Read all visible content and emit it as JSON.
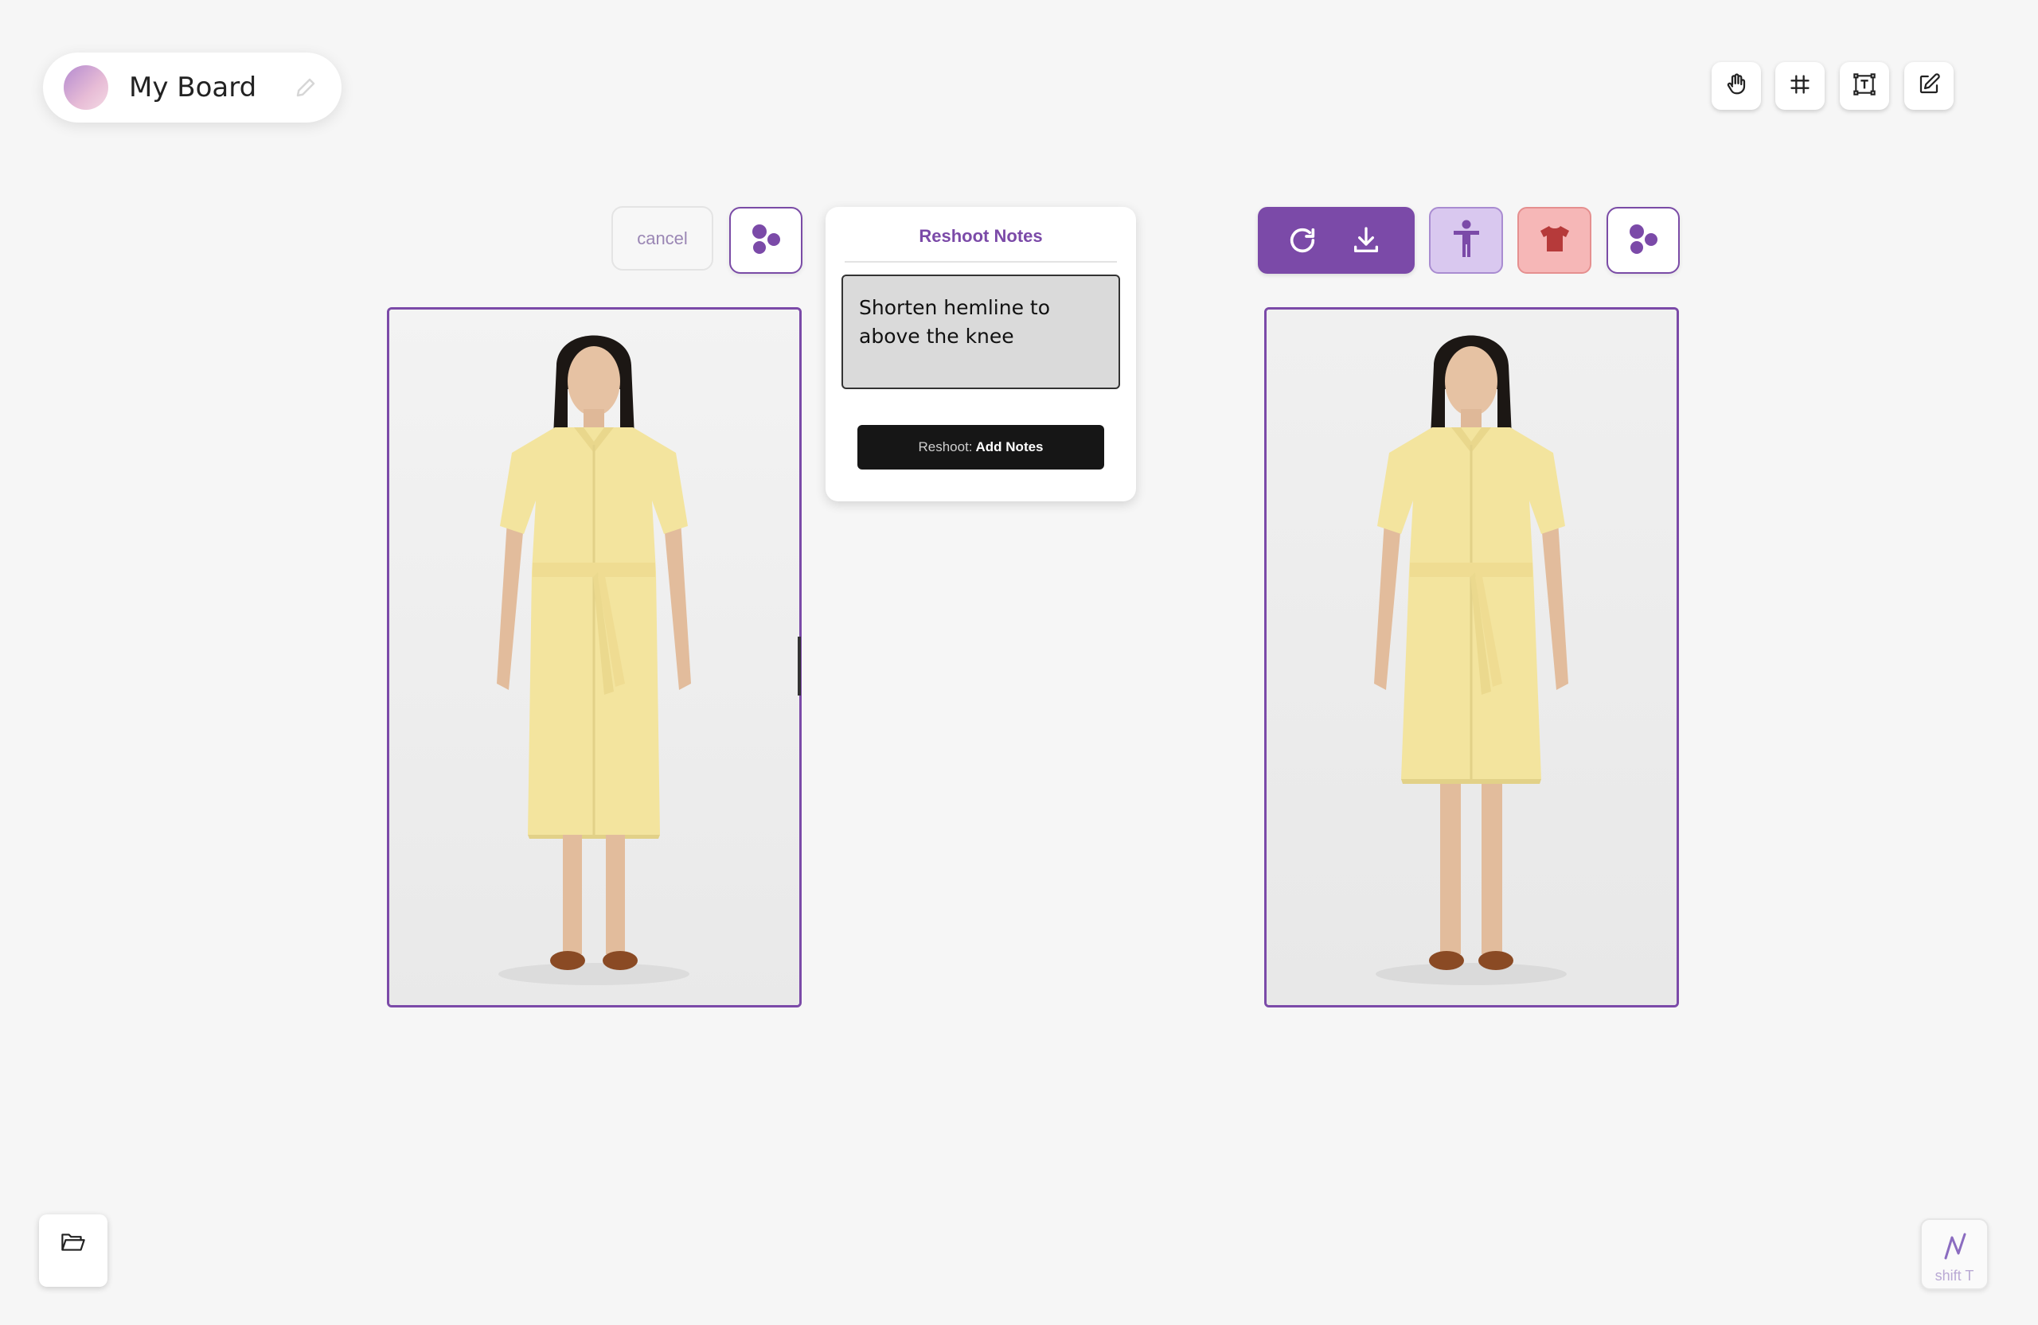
{
  "board": {
    "title": "My Board",
    "avatar_gradient": [
      "#b48ad0",
      "#f4d9e4"
    ]
  },
  "toolbar_top_right": [
    {
      "name": "hand-tool",
      "icon": "hand-icon"
    },
    {
      "name": "frame-tool",
      "icon": "hash-icon"
    },
    {
      "name": "text-tool",
      "icon": "text-box-icon"
    },
    {
      "name": "edit-tool",
      "icon": "pencil-square-icon"
    }
  ],
  "left_controls": {
    "cancel_label": "cancel",
    "dots_icon": "dots-cluster-icon"
  },
  "notes": {
    "title": "Reshoot Notes",
    "text": "Shorten hemline to above the knee",
    "button_prefix": "Reshoot:",
    "button_action": "Add Notes"
  },
  "right_controls": {
    "icons": [
      "refresh-icon",
      "download-icon",
      "person-icon",
      "shirt-icon",
      "dots-cluster-icon"
    ]
  },
  "images": [
    {
      "name": "original-image",
      "description_icon": "model-photo",
      "dress_length": "below-knee"
    },
    {
      "name": "reshoot-image",
      "description_icon": "model-photo",
      "dress_length": "above-knee"
    }
  ],
  "shortcut": {
    "label": "shift T"
  },
  "colors": {
    "accent": "#7b4aa8",
    "person_btn": "#d9c8ef",
    "shirt_btn": "#f6b7b7",
    "dress": "#f3e49e"
  }
}
